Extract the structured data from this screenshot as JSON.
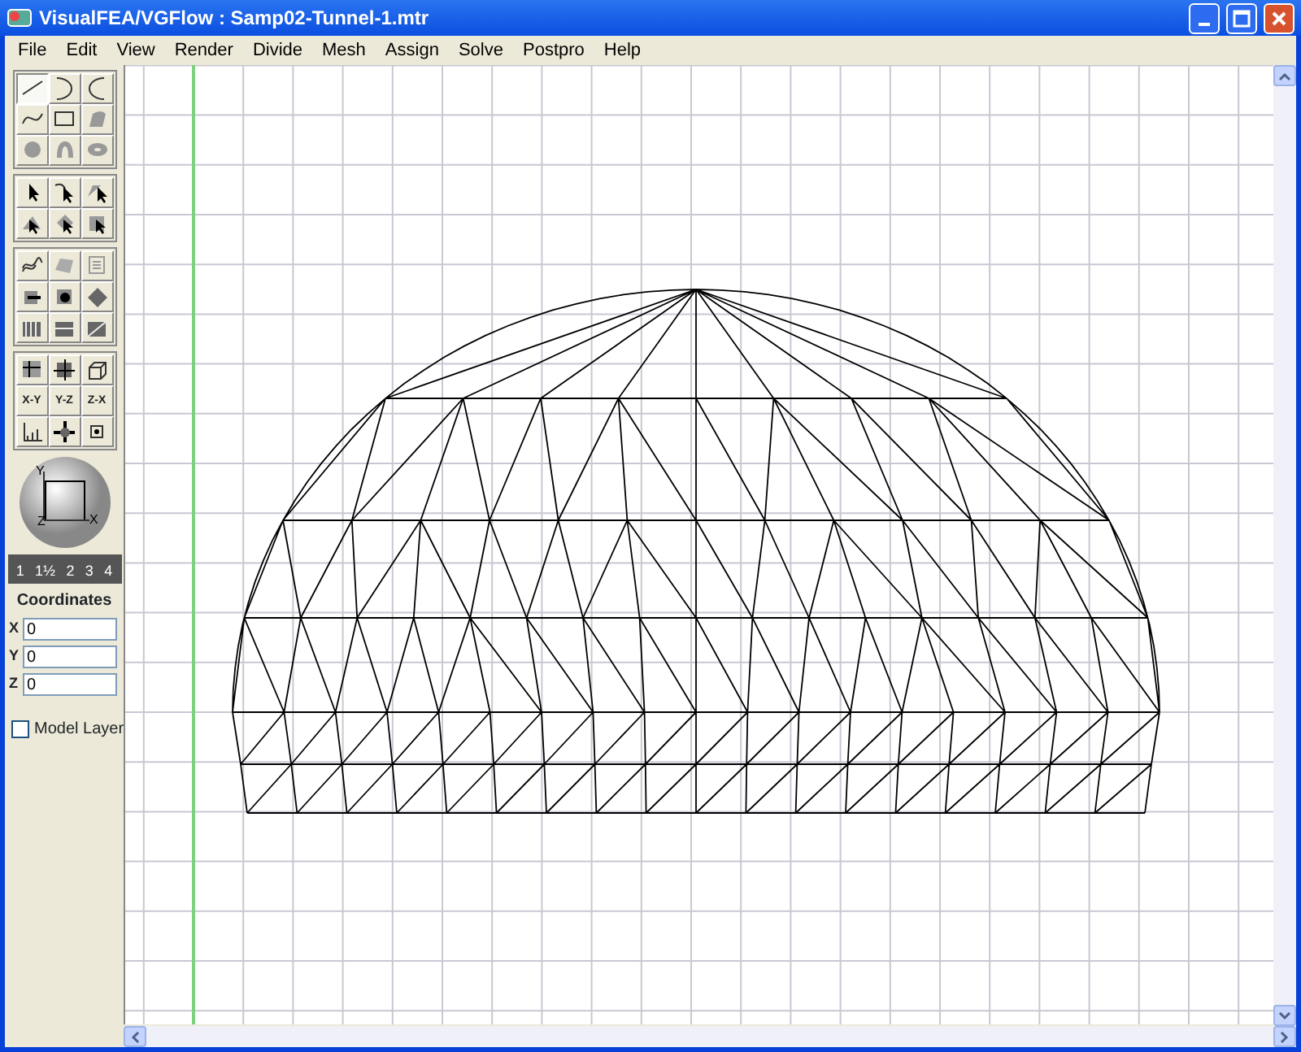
{
  "window": {
    "title": "VisualFEA/VGFlow :  Samp02-Tunnel-1.mtr"
  },
  "menu": [
    "File",
    "Edit",
    "View",
    "Render",
    "Divide",
    "Mesh",
    "Assign",
    "Solve",
    "Postpro",
    "Help"
  ],
  "tool_groups": [
    {
      "tools": [
        {
          "selected": true
        },
        {
          "selected": false
        },
        {
          "selected": false
        },
        {
          "selected": false
        },
        {
          "selected": false
        },
        {
          "selected": false
        },
        {
          "selected": false
        },
        {
          "selected": false
        },
        {
          "selected": false
        }
      ]
    },
    {
      "tools": [
        {
          "selected": false
        },
        {
          "selected": false
        },
        {
          "selected": false
        },
        {
          "selected": false
        },
        {
          "selected": false
        },
        {
          "selected": false
        }
      ]
    },
    {
      "tools": [
        {
          "selected": false
        },
        {
          "selected": false
        },
        {
          "selected": false
        },
        {
          "selected": false
        },
        {
          "selected": false
        },
        {
          "selected": false
        },
        {
          "selected": false
        },
        {
          "selected": false
        },
        {
          "selected": false
        }
      ]
    },
    {
      "tools": [
        {
          "selected": false
        },
        {
          "selected": false
        },
        {
          "selected": false
        },
        {
          "selected": false,
          "label": "X-Y"
        },
        {
          "selected": false,
          "label": "Y-Z"
        },
        {
          "selected": false,
          "label": "Z-X"
        },
        {
          "selected": false
        },
        {
          "selected": false
        },
        {
          "selected": false
        }
      ]
    }
  ],
  "orientation": {
    "axes": [
      "Y",
      "Z",
      "X"
    ]
  },
  "ruler": {
    "labels": [
      "1",
      "1½",
      "2",
      "3",
      "4"
    ]
  },
  "coordinates": {
    "title": "Coordinates",
    "fields": [
      {
        "label": "X",
        "value": "0"
      },
      {
        "label": "Y",
        "value": "0"
      },
      {
        "label": "Z",
        "value": "0"
      }
    ]
  },
  "model_layer": {
    "label": "Model Layer",
    "checked": false
  }
}
